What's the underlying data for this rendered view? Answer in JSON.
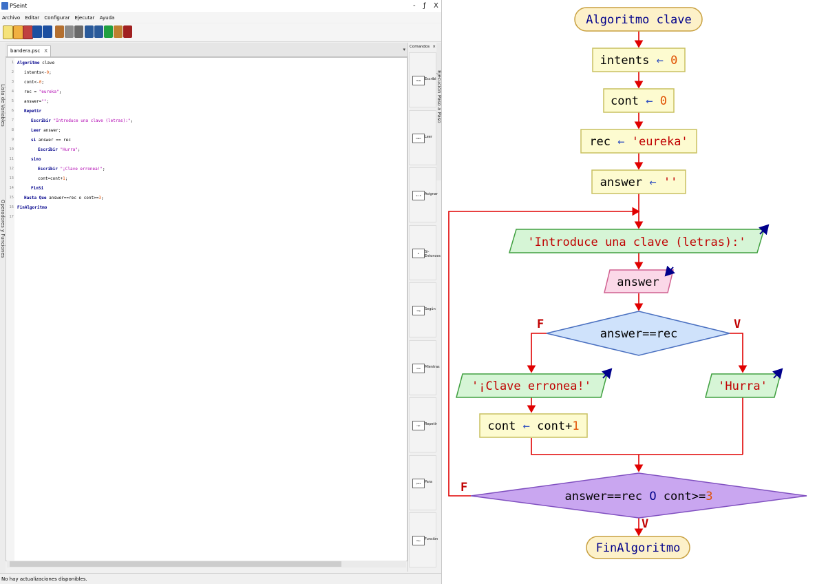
{
  "window": {
    "title": "PSeint",
    "controls": {
      "minimize": "-",
      "restore": "ƒ",
      "close": "X"
    }
  },
  "menu": [
    "Archivo",
    "Editar",
    "Configurar",
    "Ejecutar",
    "Ayuda"
  ],
  "left_tabs": {
    "variables": "Lista de Variables",
    "operators": "Operadores y Funciones"
  },
  "right_tab": "Ejecución Paso a Paso",
  "document_tab": {
    "label": "bandera.psc",
    "close": "X"
  },
  "code_lines": [
    {
      "n": "1",
      "indent": 0,
      "parts": [
        {
          "t": "Algoritmo",
          "c": "kw"
        },
        {
          "t": " clave",
          "c": ""
        }
      ]
    },
    {
      "n": "2",
      "indent": 1,
      "parts": [
        {
          "t": "intents",
          "c": ""
        },
        {
          "t": "<-",
          "c": ""
        },
        {
          "t": "0",
          "c": "nm"
        },
        {
          "t": ";",
          "c": ""
        }
      ]
    },
    {
      "n": "3",
      "indent": 1,
      "parts": [
        {
          "t": "cont",
          "c": ""
        },
        {
          "t": "<-",
          "c": ""
        },
        {
          "t": "0",
          "c": "nm"
        },
        {
          "t": ";",
          "c": ""
        }
      ]
    },
    {
      "n": "4",
      "indent": 1,
      "parts": [
        {
          "t": "rec = ",
          "c": ""
        },
        {
          "t": "\"eureka\"",
          "c": "st"
        },
        {
          "t": ";",
          "c": ""
        }
      ]
    },
    {
      "n": "5",
      "indent": 1,
      "parts": [
        {
          "t": "answer=",
          "c": ""
        },
        {
          "t": "\"\"",
          "c": "st"
        },
        {
          "t": ";",
          "c": ""
        }
      ]
    },
    {
      "n": "6",
      "indent": 1,
      "parts": [
        {
          "t": "Repetir",
          "c": "kw"
        }
      ]
    },
    {
      "n": "7",
      "indent": 2,
      "parts": [
        {
          "t": "Escribir ",
          "c": "kw"
        },
        {
          "t": "\"Introduce una clave (letras):\"",
          "c": "st"
        },
        {
          "t": ";",
          "c": ""
        }
      ]
    },
    {
      "n": "8",
      "indent": 2,
      "parts": [
        {
          "t": "Leer ",
          "c": "kw"
        },
        {
          "t": "answer;",
          "c": ""
        }
      ]
    },
    {
      "n": "9",
      "indent": 2,
      "parts": [
        {
          "t": "si ",
          "c": "kw"
        },
        {
          "t": "answer == rec",
          "c": ""
        }
      ]
    },
    {
      "n": "10",
      "indent": 3,
      "parts": [
        {
          "t": "Escribir ",
          "c": "kw"
        },
        {
          "t": "\"Hurra\"",
          "c": "st"
        },
        {
          "t": ";",
          "c": ""
        }
      ]
    },
    {
      "n": "11",
      "indent": 2,
      "parts": [
        {
          "t": "sino",
          "c": "kw"
        }
      ]
    },
    {
      "n": "12",
      "indent": 3,
      "parts": [
        {
          "t": "Escribir ",
          "c": "kw"
        },
        {
          "t": "\"¡Clave erronea!\"",
          "c": "st"
        },
        {
          "t": ";",
          "c": ""
        }
      ]
    },
    {
      "n": "13",
      "indent": 3,
      "parts": [
        {
          "t": "cont=cont+",
          "c": ""
        },
        {
          "t": "1",
          "c": "nm"
        },
        {
          "t": ";",
          "c": ""
        }
      ]
    },
    {
      "n": "14",
      "indent": 2,
      "parts": [
        {
          "t": "FinSi",
          "c": "kw"
        }
      ]
    },
    {
      "n": "15",
      "indent": 1,
      "parts": [
        {
          "t": "Hasta Que ",
          "c": "kw"
        },
        {
          "t": "answer==rec o cont>=",
          "c": ""
        },
        {
          "t": "3",
          "c": "nm"
        },
        {
          "t": ";",
          "c": ""
        }
      ]
    },
    {
      "n": "16",
      "indent": 0,
      "parts": [
        {
          "t": "FinAlgoritmo",
          "c": "kw"
        }
      ]
    },
    {
      "n": "17",
      "indent": 0,
      "parts": []
    }
  ],
  "commands_panel": {
    "title": "Comandos",
    "items": [
      {
        "label": "Escribir",
        "icon": "Hola"
      },
      {
        "label": "Leer",
        "icon": "Dato"
      },
      {
        "label": "Asignar",
        "icon": "a<-b"
      },
      {
        "label": "Si-Entonces",
        "icon": "si"
      },
      {
        "label": "Según",
        "icon": "seg"
      },
      {
        "label": "Mientras",
        "icon": "mie"
      },
      {
        "label": "Repetir",
        "icon": "rep"
      },
      {
        "label": "Para",
        "icon": "para"
      },
      {
        "label": "Función",
        "icon": "f(x)"
      }
    ]
  },
  "status": "No hay actualizaciones disponibles.",
  "colors": {
    "terminal_fill": "#fdf1c9",
    "terminal_stroke": "#c8a040",
    "process_fill": "#fdfbd0",
    "process_stroke": "#c8c060",
    "output_fill": "#d6f5d6",
    "output_stroke": "#40a040",
    "input_fill": "#fbd8e8",
    "input_stroke": "#d06090",
    "decision_fill": "#cfe2fb",
    "decision_stroke": "#4a70c0",
    "loop_fill": "#c9a6f0",
    "loop_stroke": "#8050c0",
    "arrow": "#e00000",
    "keyword_text": "#00008b",
    "number_text": "#e05000"
  },
  "flowchart": {
    "start": "Algoritmo clave",
    "assign1": {
      "var": "intents",
      "arrow": "←",
      "val": "0"
    },
    "assign2": {
      "var": "cont",
      "arrow": "←",
      "val": "0"
    },
    "assign3": {
      "var": "rec",
      "arrow": "←",
      "val": "'eureka'"
    },
    "assign4": {
      "var": "answer",
      "arrow": "←",
      "val": "''"
    },
    "write1": "'Introduce una clave (letras):'",
    "read1": "answer",
    "decision": "answer==rec",
    "false_label": "F",
    "true_label": "V",
    "write_false": "'¡Clave erronea!'",
    "write_true": "'Hurra'",
    "assign5": {
      "var": "cont",
      "arrow": "←",
      "val": "cont+",
      "num": "1"
    },
    "loop_condition": {
      "a": "answer==rec ",
      "op": "O",
      "b": " cont>=",
      "num": "3"
    },
    "loop_false": "F",
    "loop_true": "V",
    "end": "FinAlgoritmo"
  }
}
